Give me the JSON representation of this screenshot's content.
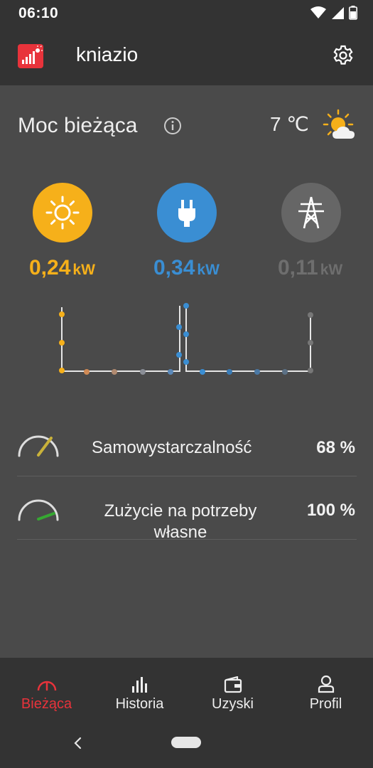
{
  "status_bar": {
    "time": "06:10",
    "icons": [
      "wifi-icon",
      "signal-icon",
      "battery-icon"
    ]
  },
  "app_bar": {
    "title": "kniazio",
    "logo": "solar-app-logo-icon",
    "settings_icon": "gear-icon"
  },
  "current": {
    "title": "Moc bieżąca",
    "info_icon": "info-icon",
    "temperature": "7 ℃",
    "weather_icon": "sun-behind-cloud-icon"
  },
  "power": {
    "solar": {
      "value": "0,24",
      "unit": "kW",
      "color": "#f6b01a",
      "icon": "sun-icon"
    },
    "consumption": {
      "value": "0,34",
      "unit": "kW",
      "color": "#3a8ed3",
      "icon": "plug-icon"
    },
    "grid": {
      "value": "0,11",
      "unit": "kW",
      "color": "#6e6e6e",
      "icon": "power-pylon-icon"
    }
  },
  "ratios": [
    {
      "label": "Samowystarczalność",
      "value": "68 %",
      "level": 0.68,
      "needle_color": "#c9b23a"
    },
    {
      "label": "Zużycie na potrzeby własne",
      "value": "100 %",
      "level": 1.0,
      "needle_color": "#36a832"
    }
  ],
  "bottom_nav": [
    {
      "label": "Bieżąca",
      "icon": "gauge-icon",
      "active": true
    },
    {
      "label": "Historia",
      "icon": "bar-chart-icon",
      "active": false
    },
    {
      "label": "Uzyski",
      "icon": "wallet-icon",
      "active": false
    },
    {
      "label": "Profil",
      "icon": "profile-icon",
      "active": false
    }
  ],
  "colors": {
    "accent": "#e8333b",
    "background": "#4a4a4a",
    "bars": "#333333"
  }
}
